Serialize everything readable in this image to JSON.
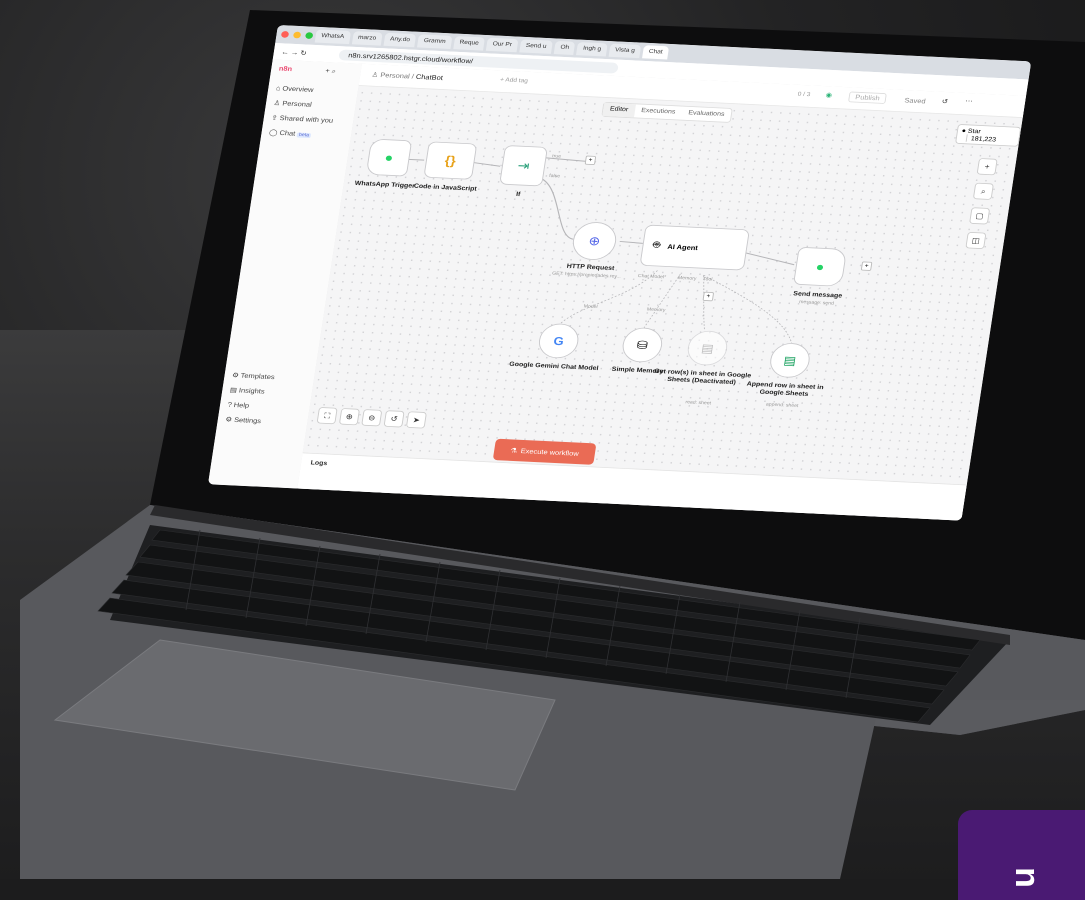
{
  "browser": {
    "tabs": [
      "WhatsA",
      "marzo",
      "Any.do",
      "Gramm",
      "Reque",
      "Our Pr",
      "Send u",
      "Oh",
      "Ingh g",
      "Vista g",
      "Chat"
    ],
    "url": "n8n.srv1265802.hstgr.cloud/workflow/"
  },
  "sidebar": {
    "logo": "n8n",
    "items": [
      "Overview",
      "Personal",
      "Shared with you",
      "Chat"
    ],
    "chat_badge": "beta",
    "bottom": [
      "Templates",
      "Insights",
      "Help",
      "Settings"
    ]
  },
  "topbar": {
    "breadcrumb_owner": "Personal",
    "breadcrumb_sep": "/",
    "breadcrumb_name": "ChatBot",
    "add_tag": "+ Add tag",
    "counter": "0 / 3",
    "publish": "Publish",
    "saved": "Saved",
    "star": "Star",
    "stars": "181,223"
  },
  "tabs": [
    "Editor",
    "Executions",
    "Evaluations"
  ],
  "nodes": {
    "whatsapp": "WhatsApp Trigger",
    "code": "Code in JavaScript",
    "if": "If",
    "if_true": "true",
    "if_false": "false",
    "http": "HTTP Request",
    "http_sub": "GET: https://propiedades.rey...",
    "agent": "AI Agent",
    "agent_chat": "Chat Model*",
    "agent_memory": "Memory",
    "agent_tool": "Tool",
    "send": "Send message",
    "send_sub": "message: send",
    "model_tag": "Model",
    "memory_tag": "Memory",
    "gemini": "Google Gemini Chat Model",
    "memory": "Simple Memory",
    "getrows": "Get row(s) in sheet in Google Sheets (Deactivated)",
    "getrows_sub": "read: sheet",
    "append": "Append row in sheet in Google Sheets",
    "append_sub": "append: sheet"
  },
  "execute": "Execute workflow",
  "logs": "Logs",
  "brand": "n",
  "colors": {
    "accent": "#ea6b55",
    "whatsapp": "#25d366",
    "sheets": "#0f9d58",
    "badge": "#4a1a73"
  }
}
